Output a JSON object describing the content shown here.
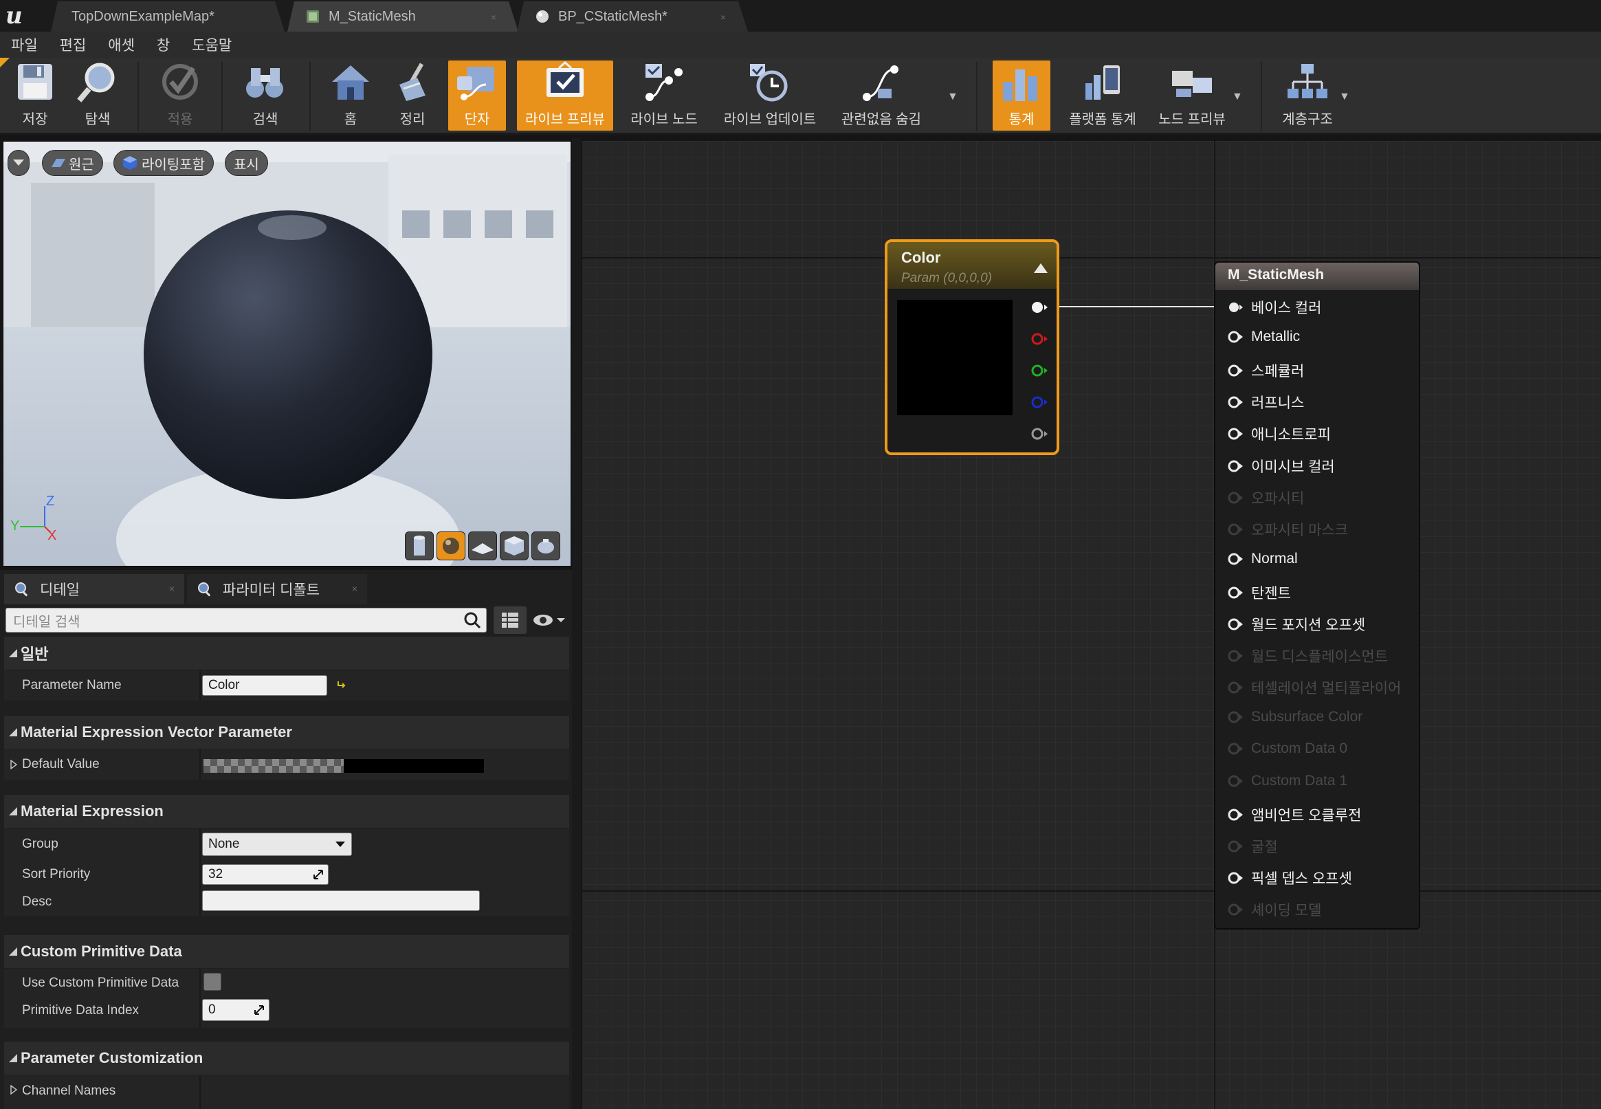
{
  "tabs": [
    {
      "label": "TopDownExampleMap*"
    },
    {
      "label": "M_StaticMesh"
    },
    {
      "label": "BP_CStaticMesh*"
    }
  ],
  "tab_close": "×",
  "menu": [
    "파일",
    "편집",
    "애셋",
    "창",
    "도움말"
  ],
  "toolbar": {
    "save": "저장",
    "browse": "탐색",
    "apply": "적용",
    "search": "검색",
    "home": "홈",
    "clean_up": "정리",
    "connectors": "단자",
    "live_preview": "라이브 프리뷰",
    "live_nodes": "라이브 노드",
    "live_update": "라이브 업데이트",
    "hide_unrelated": "관련없음 숨김",
    "stats": "통계",
    "platform_stats": "플랫폼 통계",
    "node_preview": "노드 프리뷰",
    "hierarchy": "계층구조"
  },
  "viewport": {
    "perspective": "원근",
    "lighting": "라이팅포함",
    "show": "표시",
    "axis_z": "Z",
    "axis_y": "Y",
    "axis_x": "X"
  },
  "details": {
    "tab_details": "디테일",
    "tab_param_defaults": "파라미터 디폴트",
    "search_placeholder": "디테일 검색",
    "cat_general": "일반",
    "param_name_label": "Parameter Name",
    "param_name_value": "Color",
    "cat_vector": "Material Expression Vector Parameter",
    "default_value_label": "Default Value",
    "cat_expression": "Material Expression",
    "group_label": "Group",
    "group_value": "None",
    "sort_priority_label": "Sort Priority",
    "sort_priority_value": "32",
    "desc_label": "Desc",
    "desc_value": "",
    "cat_custom_primitive": "Custom Primitive Data",
    "use_custom_label": "Use Custom Primitive Data",
    "primitive_index_label": "Primitive Data Index",
    "primitive_index_value": "0",
    "cat_param_custom": "Parameter Customization",
    "channel_names_label": "Channel Names"
  },
  "graph": {
    "color_node": {
      "title": "Color",
      "subtitle": "Param (0,0,0,0)"
    },
    "material_node": {
      "title": "M_StaticMesh",
      "pins": [
        {
          "label": "베이스 컬러",
          "enabled": true,
          "connected": true
        },
        {
          "label": "Metallic",
          "enabled": true
        },
        {
          "label": "스페큘러",
          "enabled": true
        },
        {
          "label": "러프니스",
          "enabled": true
        },
        {
          "label": "애니소트로피",
          "enabled": true
        },
        {
          "label": "이미시브 컬러",
          "enabled": true
        },
        {
          "label": "오파시티",
          "enabled": false
        },
        {
          "label": "오파시티 마스크",
          "enabled": false
        },
        {
          "label": "Normal",
          "enabled": true
        },
        {
          "label": "탄젠트",
          "enabled": true
        },
        {
          "label": "월드 포지션 오프셋",
          "enabled": true
        },
        {
          "label": "월드 디스플레이스먼트",
          "enabled": false
        },
        {
          "label": "테셀레이션 멀티플라이어",
          "enabled": false
        },
        {
          "label": "Subsurface Color",
          "enabled": false
        },
        {
          "label": "Custom Data 0",
          "enabled": false
        },
        {
          "label": "Custom Data 1",
          "enabled": false
        },
        {
          "label": "앰비언트 오클루전",
          "enabled": true
        },
        {
          "label": "굴절",
          "enabled": false
        },
        {
          "label": "픽셀 뎁스 오프셋",
          "enabled": true
        },
        {
          "label": "셰이딩 모델",
          "enabled": false
        }
      ]
    }
  },
  "colors": {
    "accent_orange": "#e8921c",
    "pin_red": "#d01a1a",
    "pin_green": "#1fb31f",
    "pin_blue": "#1a2bd0"
  }
}
